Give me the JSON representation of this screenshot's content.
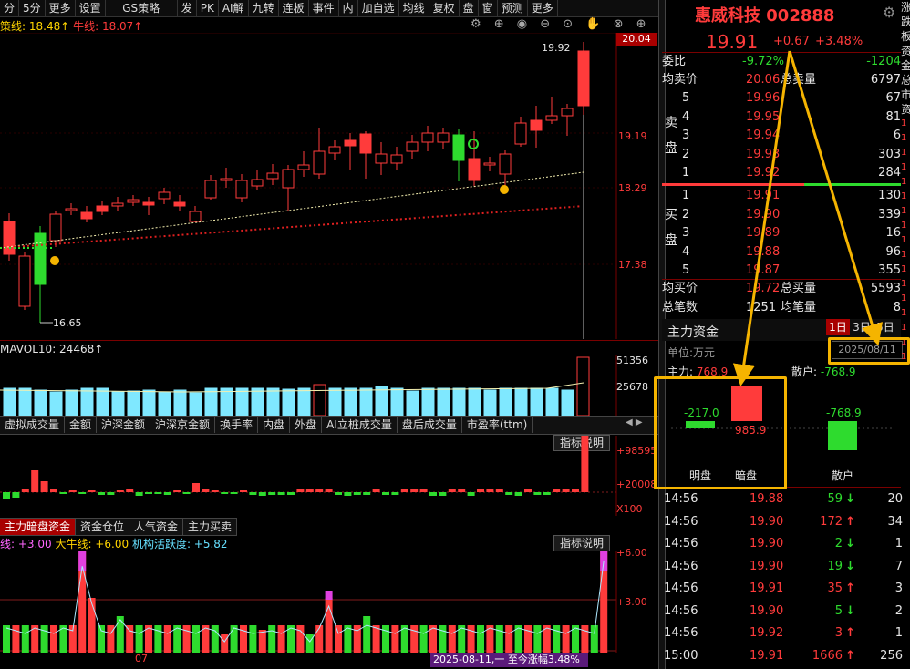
{
  "toolbar": {
    "items": [
      "分",
      "5分",
      "更多",
      "设置",
      "GS策略",
      "发",
      "PK",
      "AI解",
      "九转",
      "连板",
      "事件",
      "内",
      "加自选",
      "均线",
      "复权",
      "盘",
      "窗",
      "预测",
      "更多"
    ]
  },
  "kline_legend": {
    "line1": "策线: 18.48↑",
    "line2": "牛线: 18.07↑"
  },
  "price_axis": [
    "20.04",
    "19.19",
    "18.29",
    "17.38"
  ],
  "high_label": "19.92",
  "low_label": "16.65",
  "vol_legend": "MAVOL10: 24468↑",
  "vol_axis": [
    "51356",
    "25678"
  ],
  "indicator_tabs": [
    "虚拟成交量",
    "金额",
    "沪深金额",
    "沪深京金额",
    "换手率",
    "内盘",
    "外盘",
    "AI立桩成交量",
    "盘后成交量",
    "市盈率(ttm)"
  ],
  "indicator_button": "指标说明",
  "ind_axis": [
    "+98595",
    "+20008",
    "X100"
  ],
  "bottom_tabs": [
    "主力暗盘资金",
    "资金仓位",
    "人气资金",
    "主力买卖"
  ],
  "bottom_legend": {
    "a": "线: +3.00",
    "b": "大牛线: +6.00",
    "c": "机构活跃度: +5.82"
  },
  "bottom_axis": [
    "+6.00",
    "+3.00"
  ],
  "bottom_x_label": "07",
  "bottom_status": "2025-08-11,一 至今涨幅3.48%",
  "stock": {
    "name": "惠威科技",
    "code": "002888",
    "price": "19.91",
    "change": "+0.67",
    "pct": "+3.48%"
  },
  "quote": {
    "weibi_label": "委比",
    "weibi": "-9.72%",
    "weicha": "-1204",
    "avg_sell_label": "均卖价",
    "avg_sell": "20.06",
    "total_sell_label": "总卖量",
    "total_sell": "6797",
    "sell_side_label": "卖盘",
    "sells": [
      {
        "lvl": "5",
        "price": "19.96",
        "vol": "67"
      },
      {
        "lvl": "4",
        "price": "19.95",
        "vol": "81"
      },
      {
        "lvl": "3",
        "price": "19.94",
        "vol": "6"
      },
      {
        "lvl": "2",
        "price": "19.93",
        "vol": "303"
      },
      {
        "lvl": "1",
        "price": "19.92",
        "vol": "284"
      }
    ],
    "buy_side_label": "买盘",
    "buys": [
      {
        "lvl": "1",
        "price": "19.91",
        "vol": "130"
      },
      {
        "lvl": "2",
        "price": "19.90",
        "vol": "339"
      },
      {
        "lvl": "3",
        "price": "19.89",
        "vol": "16"
      },
      {
        "lvl": "4",
        "price": "19.88",
        "vol": "96"
      },
      {
        "lvl": "5",
        "price": "19.87",
        "vol": "355"
      }
    ],
    "avg_buy_label": "均买价",
    "avg_buy": "19.72",
    "total_buy_label": "总买量",
    "total_buy": "5593",
    "total_trades_label": "总笔数",
    "total_trades": "1251",
    "avg_trade_label": "均笔量",
    "avg_trade": "8"
  },
  "fund": {
    "title": "主力资金",
    "periods": [
      "1日",
      "3日",
      "5日"
    ],
    "unit": "单位:万元",
    "date": "2025/08/11",
    "main_label": "主力:",
    "main_value": "768.9",
    "retail_label": "散户:",
    "retail_value": "-768.9",
    "ming_value": "-217.0",
    "an_value": "985.9",
    "retail_bar_value": "-768.9",
    "ming_label": "明盘",
    "an_label": "暗盘",
    "retail_bar_label": "散户"
  },
  "ticks": [
    {
      "time": "14:56",
      "price": "19.88",
      "vol": "59",
      "dir": "down",
      "n": "20"
    },
    {
      "time": "14:56",
      "price": "19.90",
      "vol": "172",
      "dir": "up",
      "n": "34"
    },
    {
      "time": "14:56",
      "price": "19.90",
      "vol": "2",
      "dir": "down",
      "n": "1"
    },
    {
      "time": "14:56",
      "price": "19.90",
      "vol": "19",
      "dir": "down",
      "n": "7"
    },
    {
      "time": "14:56",
      "price": "19.91",
      "vol": "35",
      "dir": "up",
      "n": "3"
    },
    {
      "time": "14:56",
      "price": "19.90",
      "vol": "5",
      "dir": "down",
      "n": "2"
    },
    {
      "time": "14:56",
      "price": "19.92",
      "vol": "3",
      "dir": "up",
      "n": "1"
    },
    {
      "time": "15:00",
      "price": "19.91",
      "vol": "1666",
      "dir": "up",
      "n": "256"
    }
  ],
  "right_strip": [
    "涨",
    "跌",
    "板",
    "资",
    "金",
    "总",
    "市",
    "资",
    "1",
    "1",
    "1",
    "1",
    "1",
    "1",
    "1",
    "1",
    "1",
    "1",
    "1",
    "1",
    "1",
    "1",
    "1",
    "1",
    "1"
  ],
  "colors": {
    "up": "#ff3b3b",
    "down": "#2edb2e",
    "vol_up": "#7fe8ff",
    "highlight": "#f5b400"
  }
}
